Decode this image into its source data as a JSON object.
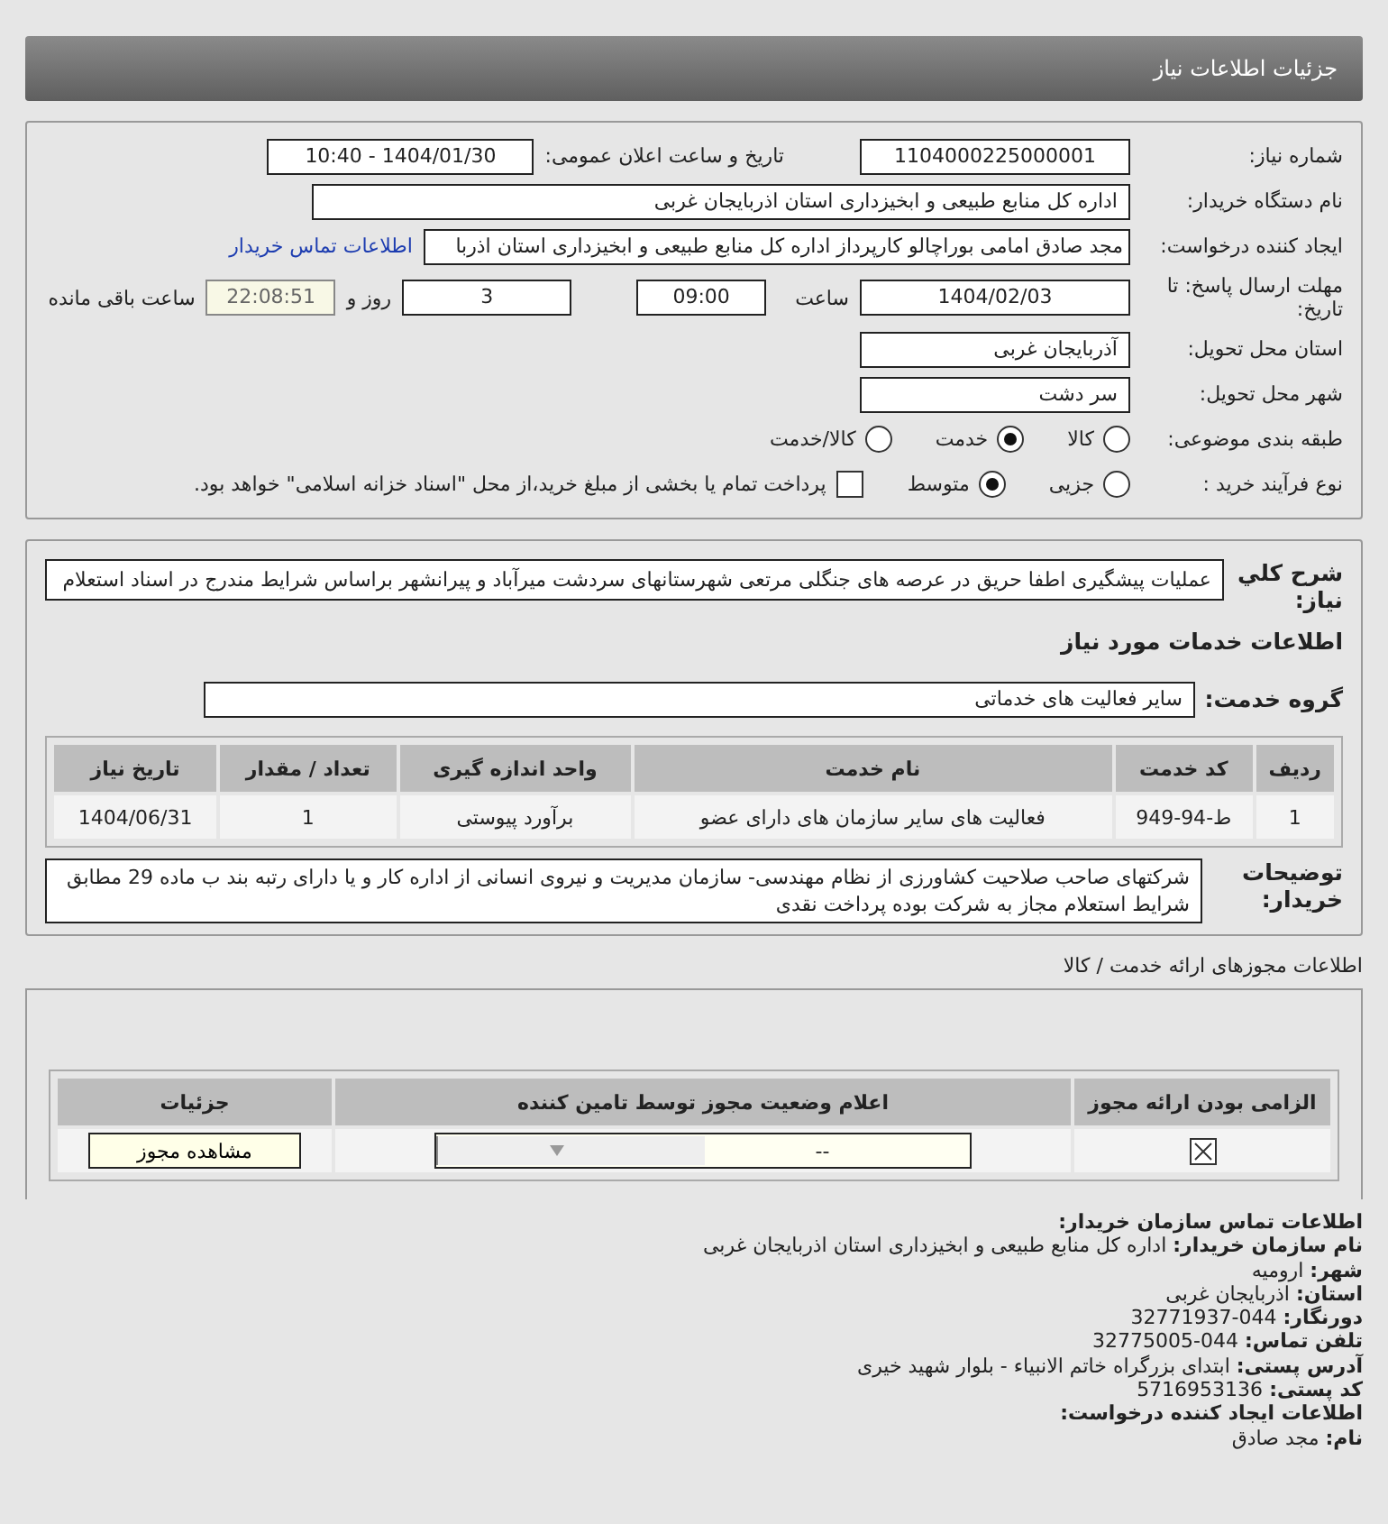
{
  "header": {
    "title": "جزئیات اطلاعات نیاز"
  },
  "need_number": {
    "label": "شماره نیاز:",
    "value": "1104000225000001"
  },
  "announce": {
    "label": "تاریخ و ساعت اعلان عمومی:",
    "value": "1404/01/30 - 10:40"
  },
  "buyer": {
    "label": "نام دستگاه خریدار:",
    "value": "اداره کل منابع طبیعی و ابخیزداری استان اذربایجان غربی"
  },
  "requester": {
    "label": "ایجاد کننده درخواست:",
    "value": "مجد صادق امامی بوراچالو کارپرداز اداره کل منابع طبیعی و ابخیزداری استان اذربا",
    "link": "اطلاعات تماس خریدار"
  },
  "deadline": {
    "label": "مهلت ارسال پاسخ: تا تاریخ:",
    "date": "1404/02/03",
    "time_label": "ساعت",
    "time": "09:00",
    "days": "3",
    "days_label": "روز و",
    "remaining": "22:08:51",
    "remaining_label": "ساعت باقی مانده"
  },
  "province": {
    "label": "استان محل تحویل:",
    "value": "آذربایجان غربی"
  },
  "city": {
    "label": "شهر محل تحویل:",
    "value": "سر دشت"
  },
  "category": {
    "label": "طبقه بندی موضوعی:",
    "options": [
      {
        "label": "کالا",
        "selected": false
      },
      {
        "label": "خدمت",
        "selected": true
      },
      {
        "label": "کالا/خدمت",
        "selected": false
      }
    ]
  },
  "process": {
    "label": "نوع فرآیند خرید :",
    "options": [
      {
        "label": "جزیی",
        "selected": false
      },
      {
        "label": "متوسط",
        "selected": true
      }
    ],
    "payment": {
      "label": "پرداخت تمام یا بخشی از مبلغ خرید،از محل \"اسناد خزانه اسلامی\" خواهد بود.",
      "checked": false
    }
  },
  "description": {
    "label": "شرح کلي نياز:",
    "text": "عملیات پیشگیری اطفا حریق در عرصه های جنگلی مرتعی شهرستانهای سردشت میرآباد و پیرانشهر براساس شرایط مندرج در اسناد استعلام"
  },
  "services_title": "اطلاعات خدمات مورد نیاز",
  "service_group": {
    "label": "گروه خدمت:",
    "value": "سایر فعالیت های خدماتی"
  },
  "table": {
    "columns": [
      "ردیف",
      "کد خدمت",
      "نام خدمت",
      "واحد اندازه گیری",
      "تعداد / مقدار",
      "تاریخ نیاز"
    ],
    "rows": [
      [
        "1",
        "ط-94-949",
        "فعالیت های سایر سازمان های دارای عضو",
        "برآورد پیوستی",
        "1",
        "1404/06/31"
      ]
    ]
  },
  "buyer_notes": {
    "label": "توضیحات خریدار:",
    "text": "شرکتهای صاحب صلاحیت کشاورزی از نظام مهندسی- سازمان مدیریت و نیروی انسانی از اداره کار و یا دارای رتبه بند ب ماده 29 مطابق شرایط استعلام مجاز به شرکت بوده پرداخت نقدی"
  },
  "permits": {
    "title": "اطلاعات مجوزهای ارائه خدمت / کالا",
    "columns": [
      "الزامی بودن ارائه مجوز",
      "اعلام وضعیت مجوز توسط تامین کننده",
      "جزئیات"
    ],
    "rows": [
      {
        "required": true,
        "status": "--",
        "button": "مشاهده مجوز"
      }
    ]
  },
  "contact": {
    "lines": [
      {
        "kind": "heading",
        "text": "اطلاعات تماس سازمان خریدار:"
      },
      {
        "kind": "line",
        "text": "**نام سازمان خریدار:** اداره کل منابع طبیعی و ابخیزداری استان اذربایجان غربی"
      },
      {
        "kind": "line",
        "text": "**شهر:** ارومیه"
      },
      {
        "kind": "line",
        "text": "**استان:** اذربایجان غربی"
      },
      {
        "kind": "line",
        "text": "**دورنگار:** 044-32771937"
      },
      {
        "kind": "line",
        "text": "**تلفن تماس:** 044-32775005"
      },
      {
        "kind": "line",
        "text": "**آدرس پستی:** ابتدای بزرگراه خاتم الانبیاء - بلوار شهید خیری"
      },
      {
        "kind": "line",
        "text": "**کد پستی:** 5716953136"
      },
      {
        "kind": "heading",
        "text": "اطلاعات ایجاد کننده درخواست:"
      },
      {
        "kind": "line",
        "text": "**نام:** مجد صادق"
      }
    ]
  }
}
